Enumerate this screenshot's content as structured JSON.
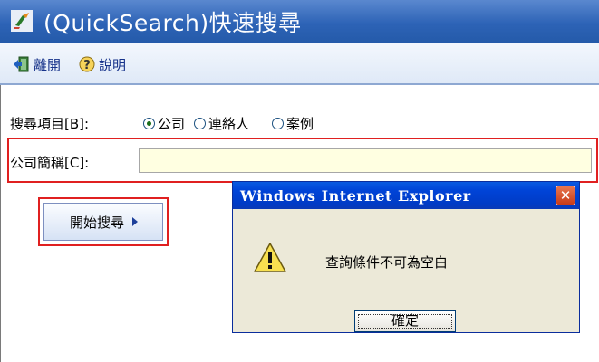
{
  "window": {
    "title": "(QuickSearch)快速搜尋"
  },
  "toolbar": {
    "exit_label": "離開",
    "help_label": "說明"
  },
  "form": {
    "search_item_label": "搜尋項目[B]:",
    "radio_options": [
      {
        "label": "公司",
        "selected": true
      },
      {
        "label": "連絡人",
        "selected": false
      },
      {
        "label": "案例",
        "selected": false
      }
    ],
    "company_short_label": "公司簡稱[C]:",
    "company_short_value": "",
    "start_button_label": "開始搜尋"
  },
  "dialog": {
    "title": "Windows Internet Explorer",
    "message": "查詢條件不可為空白",
    "ok_label": "確定",
    "close_icon": "close-icon",
    "warning_icon": "warning-icon"
  },
  "colors": {
    "titlebar": "#2d63b6",
    "highlight_border": "#e02020",
    "input_bg": "#ffffe1"
  }
}
